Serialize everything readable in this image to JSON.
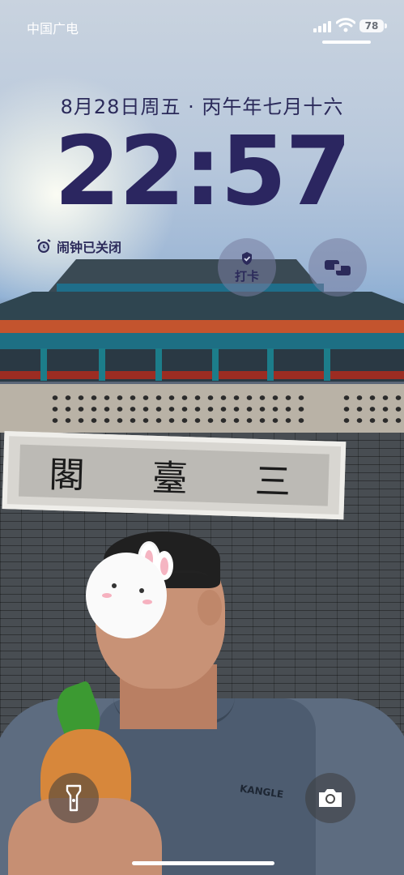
{
  "status_bar": {
    "carrier": "中国广电",
    "battery": "78",
    "icons": [
      "signal-icon",
      "wifi-icon",
      "battery-icon"
    ]
  },
  "lock_screen": {
    "date": "8月28日周五 · 丙午年七月十六",
    "time": "22:57",
    "alarm_text": "闹钟已关闭"
  },
  "widgets": {
    "checkin_label": "打卡",
    "checkin_icon": "checkin-badge-icon",
    "switch_icon": "switch-icon"
  },
  "shortcuts": {
    "left": "flashlight-icon",
    "right": "camera-icon"
  },
  "wallpaper": {
    "plaque_text": [
      "閣",
      "臺",
      "三"
    ],
    "shirt_brand": "KANGLE"
  },
  "colors": {
    "clock": "#2b2660",
    "date": "#2b2a5a",
    "widget_bg": "rgba(120,125,160,0.55)"
  }
}
